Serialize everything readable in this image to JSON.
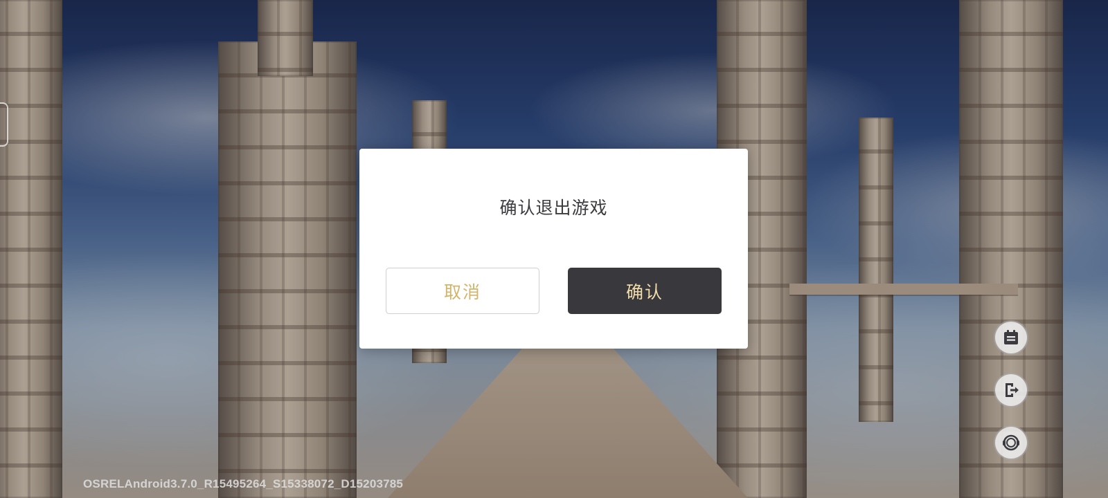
{
  "dialog": {
    "title": "确认退出游戏",
    "cancel_label": "取消",
    "confirm_label": "确认"
  },
  "side_buttons": [
    {
      "icon": "notice-board-icon"
    },
    {
      "icon": "exit-icon"
    },
    {
      "icon": "customer-service-icon"
    }
  ],
  "footer": {
    "version": "OSRELAndroid3.7.0_R15495264_S15338072_D15203785"
  },
  "colors": {
    "cancel_text": "#d3b46a",
    "confirm_bg": "#38383d",
    "confirm_text": "#f1dcaa",
    "dialog_bg": "#ffffff"
  }
}
